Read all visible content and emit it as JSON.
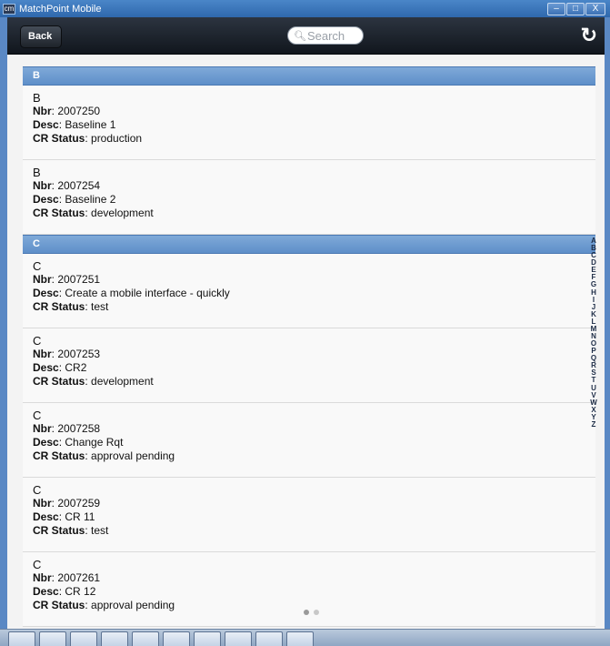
{
  "window": {
    "title": "MatchPoint Mobile",
    "icon_text": "cm",
    "controls": [
      "–",
      "□",
      "X"
    ]
  },
  "header": {
    "back_label": "Back",
    "search_placeholder": "Search"
  },
  "list": {
    "groups": [
      {
        "letter": "B",
        "items": [
          {
            "title": "B",
            "nbr": "2007250",
            "desc": "Baseline 1",
            "status": "production"
          },
          {
            "title": "B",
            "nbr": "2007254",
            "desc": "Baseline 2",
            "status": "development"
          }
        ]
      },
      {
        "letter": "C",
        "items": [
          {
            "title": "C",
            "nbr": "2007251",
            "desc": "Create a mobile interface - quickly",
            "status": "test"
          },
          {
            "title": "C",
            "nbr": "2007253",
            "desc": "CR2",
            "status": "development"
          },
          {
            "title": "C",
            "nbr": "2007258",
            "desc": "Change Rqt",
            "status": "approval pending"
          },
          {
            "title": "C",
            "nbr": "2007259",
            "desc": "CR 11",
            "status": "test"
          },
          {
            "title": "C",
            "nbr": "2007261",
            "desc": "CR 12",
            "status": "approval pending"
          }
        ]
      }
    ],
    "field_labels": {
      "nbr": "Nbr",
      "desc": "Desc",
      "status": "CR Status"
    }
  },
  "index_letters": [
    "A",
    "B",
    "C",
    "D",
    "E",
    "F",
    "G",
    "H",
    "I",
    "J",
    "K",
    "L",
    "M",
    "N",
    "O",
    "P",
    "Q",
    "R",
    "S",
    "T",
    "U",
    "V",
    "W",
    "X",
    "Y",
    "Z"
  ],
  "pager": {
    "pages": 2,
    "active": 1
  }
}
